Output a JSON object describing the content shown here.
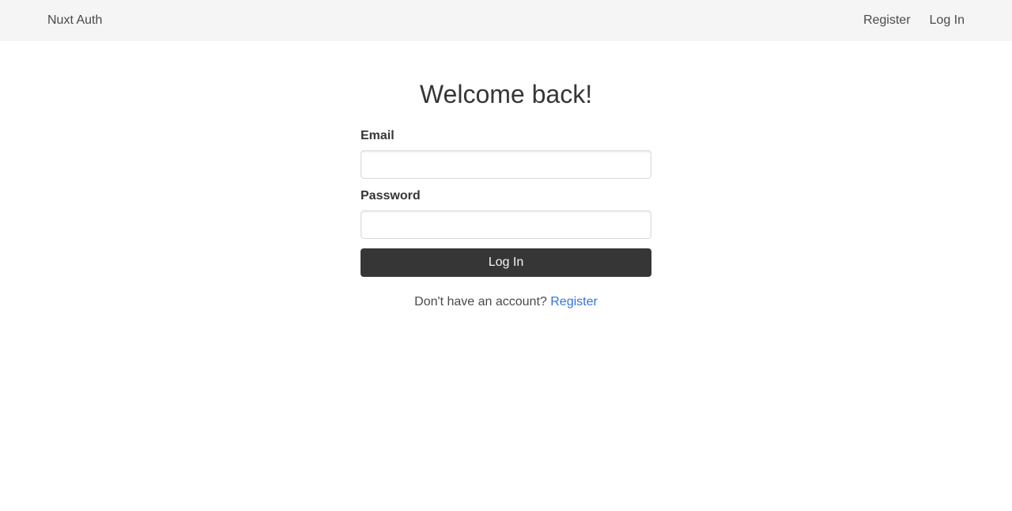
{
  "navbar": {
    "brand": "Nuxt Auth",
    "links": [
      {
        "label": "Register"
      },
      {
        "label": "Log In"
      }
    ]
  },
  "form": {
    "title": "Welcome back!",
    "email": {
      "label": "Email",
      "value": "",
      "placeholder": ""
    },
    "password": {
      "label": "Password",
      "value": "",
      "placeholder": ""
    },
    "submit_label": "Log In",
    "signup_prompt": "Don't have an account?",
    "signup_link": "Register"
  },
  "colors": {
    "navbar_bg": "#f5f5f5",
    "button_bg": "#363636",
    "link": "#3273dc",
    "text": "#363636"
  }
}
